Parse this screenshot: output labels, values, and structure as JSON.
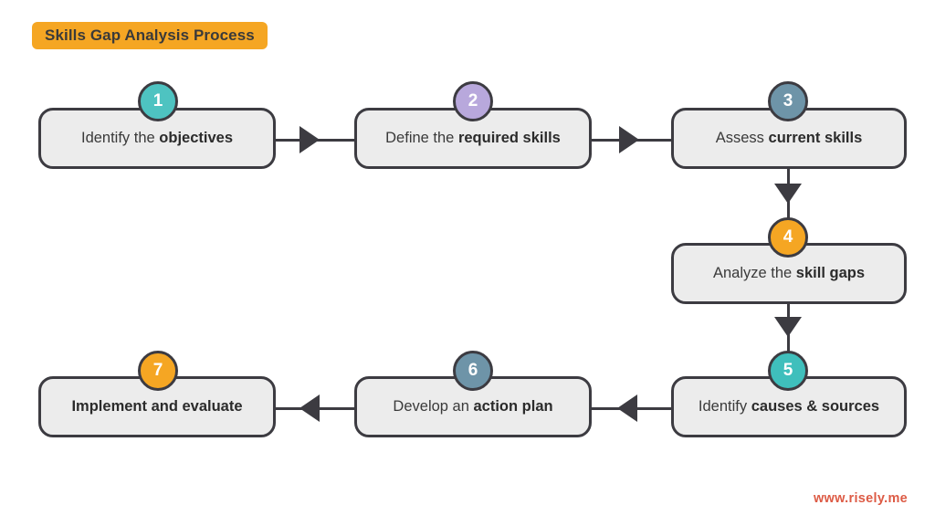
{
  "title": {
    "text": "Skills Gap Analysis Process",
    "background_color": "#F5A623",
    "text_color": "#3A3A3A"
  },
  "diagram": {
    "type": "flowchart",
    "flow_direction": "serpentine-left-to-right-then-down-then-right-to-left",
    "box_fill_color": "#ECECEC",
    "box_border_color": "#3C3B41",
    "connector_color": "#3C3B41",
    "steps": [
      {
        "number": "1",
        "badge_color": "#4EC3C1",
        "text_plain": "Identify the objectives",
        "text_normal": "Identify the ",
        "text_bold": "objectives",
        "all_bold": false
      },
      {
        "number": "2",
        "badge_color": "#B8A8DC",
        "text_plain": "Define the required skills",
        "text_normal": "Define the ",
        "text_bold": "required skills",
        "all_bold": false
      },
      {
        "number": "3",
        "badge_color": "#6E94A8",
        "text_plain": "Assess current skills",
        "text_normal": "Assess ",
        "text_bold": "current skills",
        "all_bold": false
      },
      {
        "number": "4",
        "badge_color": "#F5A623",
        "text_plain": "Analyze the skill gaps",
        "text_normal": "Analyze the ",
        "text_bold": "skill gaps",
        "all_bold": false
      },
      {
        "number": "5",
        "badge_color": "#3FBFBC",
        "text_plain": "Identify causes & sources",
        "text_normal": "Identify ",
        "text_bold": "causes & sources",
        "all_bold": false
      },
      {
        "number": "6",
        "badge_color": "#6E94A8",
        "text_plain": "Develop an action plan",
        "text_normal": "Develop an ",
        "text_bold": "action plan",
        "all_bold": false
      },
      {
        "number": "7",
        "badge_color": "#F5A623",
        "text_plain": "Implement and evaluate",
        "text_normal": "",
        "text_bold": "Implement and evaluate",
        "all_bold": true
      }
    ],
    "connectors": [
      {
        "from": "1",
        "to": "2",
        "direction": "right"
      },
      {
        "from": "2",
        "to": "3",
        "direction": "right"
      },
      {
        "from": "3",
        "to": "4",
        "direction": "down"
      },
      {
        "from": "4",
        "to": "5",
        "direction": "down"
      },
      {
        "from": "5",
        "to": "6",
        "direction": "left"
      },
      {
        "from": "6",
        "to": "7",
        "direction": "left"
      }
    ]
  },
  "footer": {
    "url": "www.risely.me",
    "color": "#DD5B45"
  }
}
